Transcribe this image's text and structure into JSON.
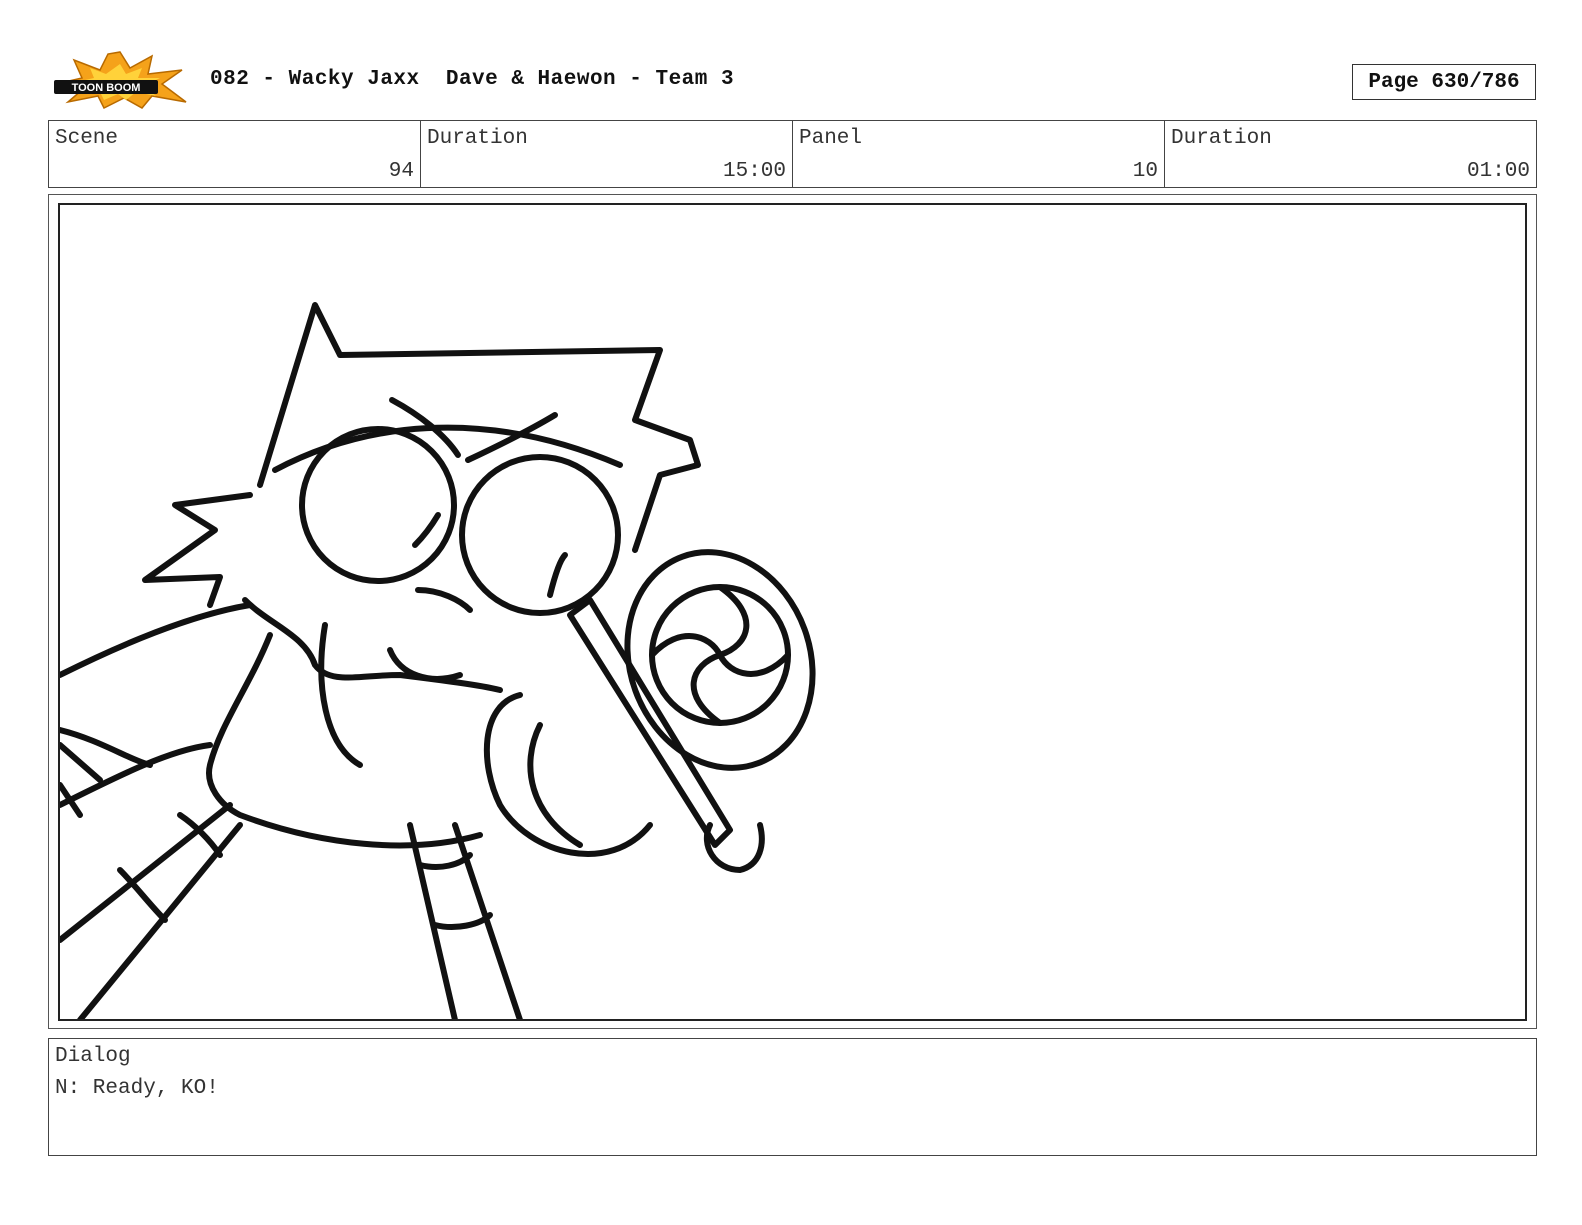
{
  "header": {
    "logo_text": "TOON BOOM",
    "title": "082 - Wacky Jaxx  Dave & Haewon - Team 3",
    "page": "Page 630/786"
  },
  "info": {
    "scene_label": "Scene",
    "scene_value": "94",
    "scene_duration_label": "Duration",
    "scene_duration_value": "15:00",
    "panel_label": "Panel",
    "panel_value": "10",
    "panel_duration_label": "Duration",
    "panel_duration_value": "01:00"
  },
  "dialog": {
    "label": "Dialog",
    "text": "N: Ready, KO!"
  }
}
